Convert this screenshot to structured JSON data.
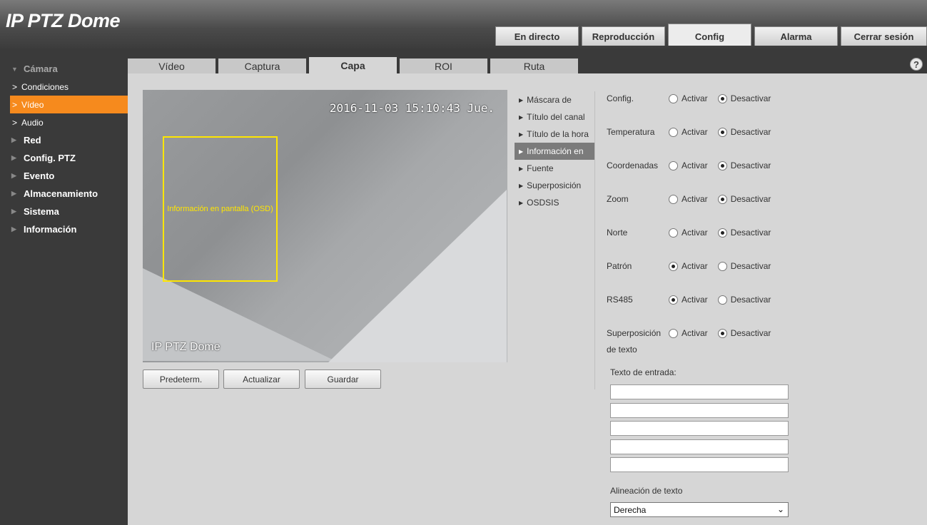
{
  "header": {
    "logo": "IP PTZ Dome",
    "tabs": [
      "En directo",
      "Reproducción",
      "Config",
      "Alarma",
      "Cerrar sesión"
    ]
  },
  "sidebar": {
    "camera": "Cámara",
    "camera_sub": [
      "Condiciones",
      "Vídeo",
      "Audio"
    ],
    "items": [
      "Red",
      "Config. PTZ",
      "Evento",
      "Almacenamiento",
      "Sistema",
      "Información"
    ]
  },
  "subtabs": [
    "Vídeo",
    "Captura",
    "Capa",
    "ROI",
    "Ruta"
  ],
  "video": {
    "timestamp": "2016-11-03 15:10:43 Jue.",
    "osd_label": "Información en pantalla (OSD)",
    "channel": "IP PTZ Dome"
  },
  "buttons": {
    "default": "Predeterm.",
    "refresh": "Actualizar",
    "save": "Guardar"
  },
  "submenu": [
    "Máscara de",
    "Título del canal",
    "Título de la hora",
    "Información en",
    "Fuente",
    "Superposición",
    "OSDSIS"
  ],
  "options": {
    "on": "Activar",
    "off": "Desactivar"
  },
  "settings": {
    "config": {
      "label": "Config.",
      "value": "Desactivar"
    },
    "temperature": {
      "label": "Temperatura",
      "value": "Desactivar"
    },
    "coordinates": {
      "label": "Coordenadas",
      "value": "Desactivar"
    },
    "zoom": {
      "label": "Zoom",
      "value": "Desactivar"
    },
    "north": {
      "label": "Norte",
      "value": "Desactivar"
    },
    "pattern": {
      "label": "Patrón",
      "value": "Activar"
    },
    "rs485": {
      "label": "RS485",
      "value": "Activar"
    },
    "text_overlay": {
      "label1": "Superposición",
      "label2": "de texto",
      "value": "Desactivar"
    }
  },
  "text_input_label": "Texto de entrada:",
  "text_inputs": [
    "",
    "",
    "",
    "",
    ""
  ],
  "alignment": {
    "label": "Alineación de texto",
    "value": "Derecha"
  },
  "colors": {
    "accent": "#f68a1d",
    "osd": "#ffe600",
    "sidebar": "#3a3a3a"
  }
}
